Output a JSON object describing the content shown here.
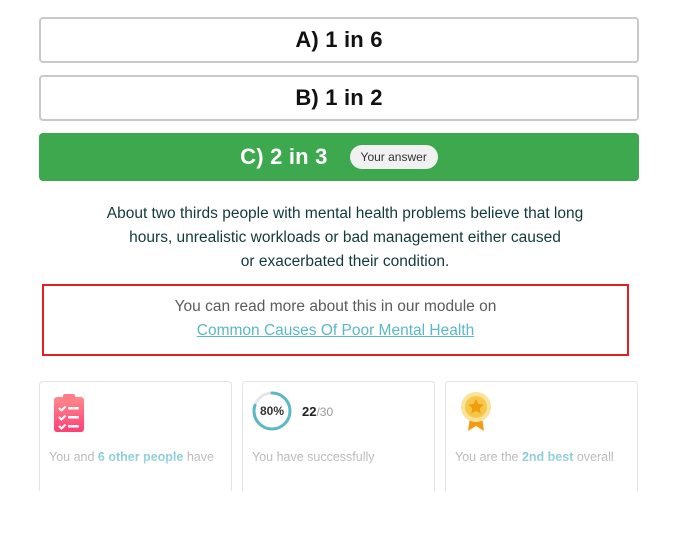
{
  "options": [
    {
      "label": "A) 1 in 6"
    },
    {
      "label": "B) 1 in 2"
    },
    {
      "label": "C) 2 in 3",
      "badge": "Your answer",
      "selected": true
    }
  ],
  "explanation": {
    "line1": "About two thirds people with mental health problems believe that long",
    "line2": "hours, unrealistic workloads or bad management either caused",
    "line3": "or exacerbated their condition."
  },
  "more_info": {
    "text": "You can read more about this in our module on",
    "link": "Common Causes Of Poor Mental Health"
  },
  "cards": {
    "participants": {
      "icon": "checklist-icon",
      "text_pre": "You and ",
      "highlight": "6 other people",
      "text_post": " have"
    },
    "score": {
      "percent_label": "80%",
      "percent_value": 0.8,
      "correct": "22",
      "total": "/30",
      "text": "You have successfully"
    },
    "rank": {
      "icon": "award-medal-icon",
      "text_pre": "You are the ",
      "highlight": "2nd best",
      "text_post": " overall"
    }
  },
  "colors": {
    "selected": "#3ea84e",
    "accent": "#5ab8c7",
    "annotation": "#e51f1f"
  }
}
